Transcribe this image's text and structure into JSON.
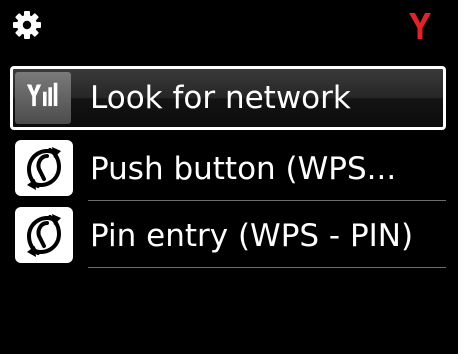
{
  "status_bar": {
    "settings_icon": "gear-icon",
    "signal_icon": "antenna-icon",
    "signal_color": "#e0232a"
  },
  "menu": {
    "items": [
      {
        "label": "Look for network",
        "icon": "signal-strength-icon",
        "selected": true
      },
      {
        "label": "Push button (WPS...",
        "icon": "wps-icon",
        "selected": false
      },
      {
        "label": "Pin entry (WPS - PIN)",
        "icon": "wps-icon",
        "selected": false
      }
    ]
  }
}
